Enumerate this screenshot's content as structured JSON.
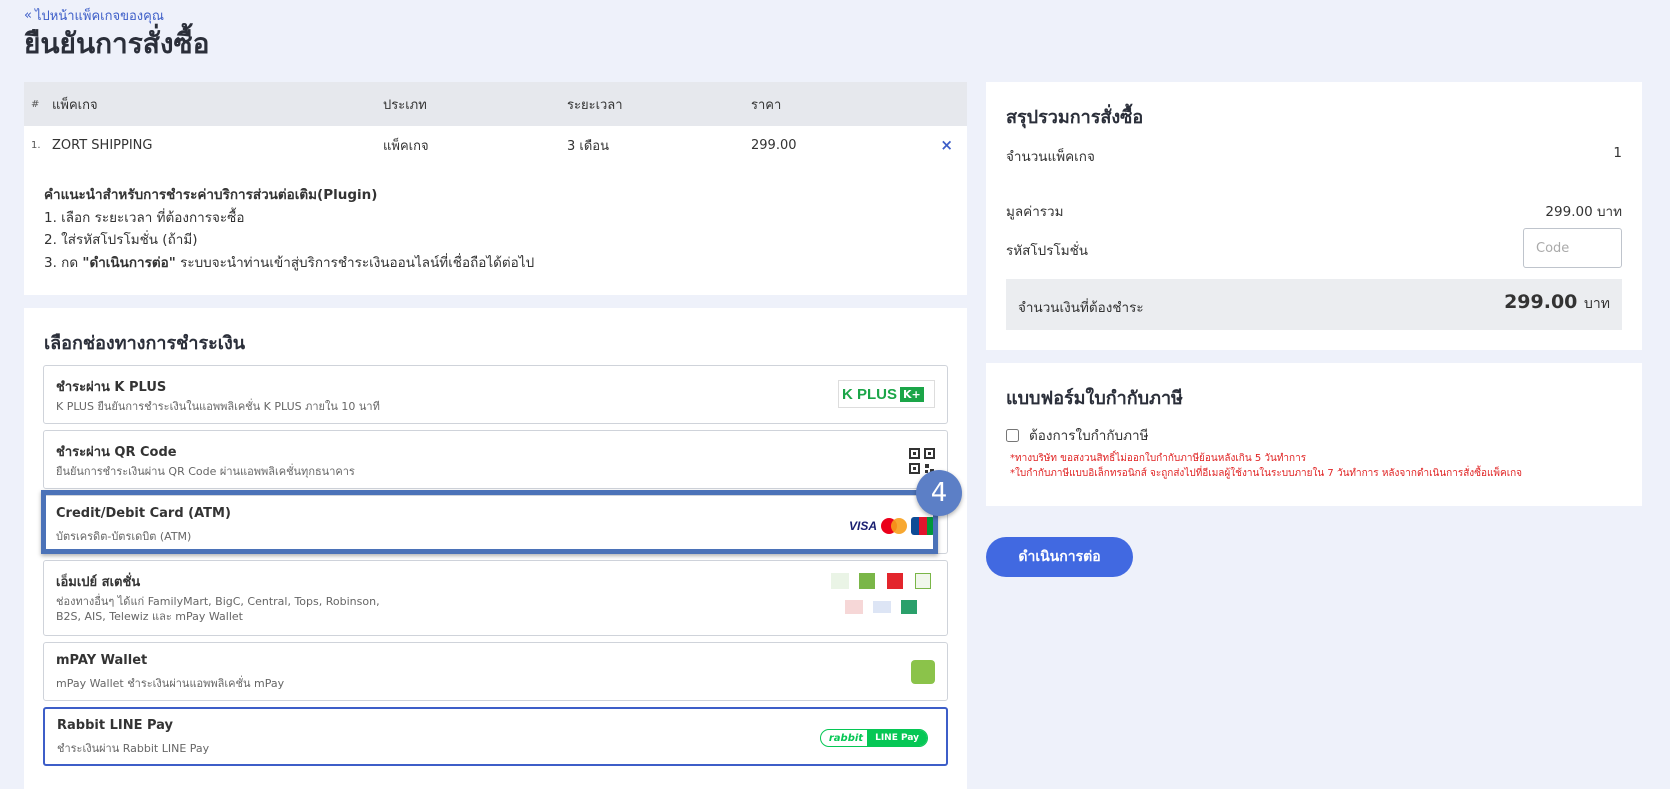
{
  "header": {
    "back_label": "ไปหน้าแพ็คเกจของคุณ",
    "title": "ยืนยันการสั่งซื้อ"
  },
  "package_table": {
    "headers": [
      "#",
      "แพ็คเกจ",
      "ประเภท",
      "ระยะเวลา",
      "ราคา"
    ],
    "rows": [
      {
        "num": "1.",
        "name": "ZORT SHIPPING",
        "type": "แพ็คเกจ",
        "duration": "3 เดือน",
        "price": "299.00"
      }
    ],
    "remove_icon": "×"
  },
  "hint": {
    "title": "คำแนะนำสำหรับการชำระค่าบริการส่วนต่อเติม(Plugin)",
    "step1": "1. เลือก ระยะเวลา ที่ต้องการจะซื้อ",
    "step2": "2. ใส่รหัสโปรโมชั่น (ถ้ามี)",
    "step3_prefix": "3. กด ",
    "step3_bold": "\"ดำเนินการต่อ\"",
    "step3_suffix": " ระบบจะนำท่านเข้าสู่บริการชำระเงินออนไลน์ที่เชื่อถือได้ต่อไป"
  },
  "payment": {
    "title": "เลือกช่องทางการชำระเงิน",
    "options": [
      {
        "name": "ชำระผ่าน K PLUS",
        "desc": "K PLUS ยืนยันการชำระเงินในแอพพลิเคชั่น K PLUS ภายใน 10 นาที",
        "logo_text": "K PLUS"
      },
      {
        "name": "ชำระผ่าน QR Code",
        "desc": "ยืนยันการชำระเงินผ่าน QR Code ผ่านแอพพลิเคชั่นทุกธนาคาร"
      },
      {
        "name": "Credit/Debit Card (ATM)",
        "desc": "บัตรเครดิต-บัตรเดบิต (ATM)",
        "logo_text": "VISA"
      },
      {
        "name": "เอ็มเปย์ สเตชั่น",
        "desc": "ช่องทางอื่นๆ ได้แก่ FamilyMart, BigC, Central, Tops, Robinson, B2S, AIS, Telewiz และ mPay Wallet"
      },
      {
        "name": "mPAY Wallet",
        "desc": "mPay Wallet ชำระเงินผ่านแอพพลิเคชั่น mPay"
      },
      {
        "name": "Rabbit LINE Pay",
        "desc": "ชำระเงินผ่าน Rabbit LINE Pay",
        "logo_left": "rabbit",
        "logo_right": "LINE Pay"
      }
    ],
    "step_badge": "4"
  },
  "summary": {
    "title": "สรุปรวมการสั่งซื้อ",
    "count_label": "จำนวนแพ็คเกจ",
    "count_value": "1",
    "subtotal_label": "มูลค่ารวม",
    "subtotal_value": "299.00 บาท",
    "promo_label": "รหัสโปรโมชั่น",
    "promo_placeholder": "Code",
    "total_label": "จำนวนเงินที่ต้องชำระ",
    "total_amount": "299.00",
    "total_unit": "บาท"
  },
  "tax_form": {
    "title": "แบบฟอร์มใบกำกับภาษี",
    "checkbox_label": "ต้องการใบกำกับภาษี",
    "note1": "*ทางบริษัท ขอสงวนสิทธิ์ไม่ออกใบกำกับภาษีย้อนหลังเกิน 5 วันทำการ",
    "note2": "*ใบกำกับภาษีแบบอิเล็กทรอนิกส์ จะถูกส่งไปที่อีเมลผู้ใช้งานในระบบภายใน 7 วันทำการ หลังจากดำเนินการสั่งซื้อแพ็คเกจ"
  },
  "continue_label": "ดำเนินการต่อ",
  "colors": {
    "accent": "#4169e1",
    "highlight": "#4b72b8",
    "note_red": "#e02424",
    "kplus_green": "#1ba548"
  }
}
